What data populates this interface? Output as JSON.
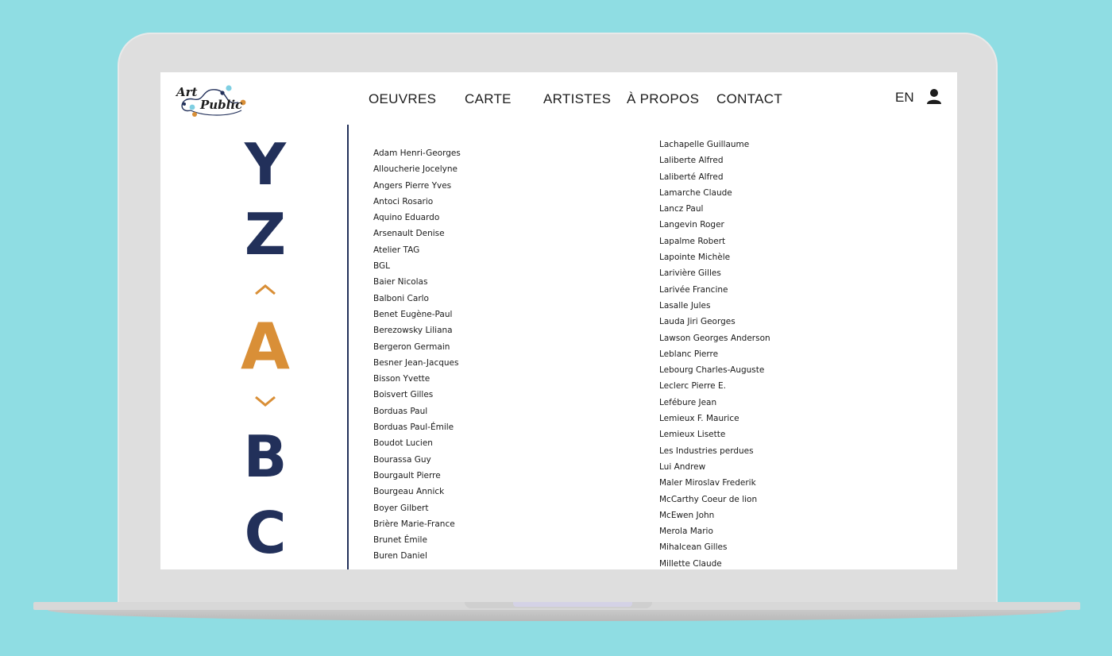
{
  "logo": {
    "line1": "Art",
    "line2": "Public"
  },
  "nav": [
    "OEUVRES",
    "CARTE",
    "ARTISTES",
    "À PROPOS",
    "CONTACT"
  ],
  "language": "EN",
  "icons": {
    "account": "user-icon",
    "prev": "chevron-up-icon",
    "next": "chevron-down-icon"
  },
  "colors": {
    "navy": "#22305a",
    "accent": "#d98f37",
    "background": "#8fdde3"
  },
  "alphabet": {
    "before": [
      "Y",
      "Z"
    ],
    "active": "A",
    "after": [
      "B",
      "C"
    ]
  },
  "artists_column1": [
    "Adam Henri-Georges",
    "Alloucherie Jocelyne",
    "Angers Pierre Yves",
    "Antoci Rosario",
    "Aquino Eduardo",
    "Arsenault Denise",
    "Atelier TAG",
    "BGL",
    "Baier Nicolas",
    "Balboni Carlo",
    "Benet Eugène-Paul",
    "Berezowsky Liliana",
    "Bergeron Germain",
    "Besner Jean-Jacques",
    "Bisson Yvette",
    "Boisvert Gilles",
    "Borduas Paul",
    "Borduas Paul-Émile",
    "Boudot Lucien",
    "Bourassa Guy",
    "Bourgault Pierre",
    "Bourgeau Annick",
    "Boyer Gilbert",
    "Brière Marie-France",
    "Brunet Émile",
    "Buren Daniel"
  ],
  "artists_column2": [
    "Lachapelle Guillaume",
    "Laliberte Alfred",
    "Laliberté Alfred",
    "Lamarche Claude",
    "Lancz Paul",
    "Langevin Roger",
    "Lapalme Robert",
    "Lapointe Michèle",
    "Larivière Gilles",
    "Larivée Francine",
    "Lasalle Jules",
    "Lauda Jiri Georges",
    "Lawson Georges Anderson",
    "Leblanc Pierre",
    "Lebourg Charles-Auguste",
    "Leclerc Pierre E.",
    "Lefébure Jean",
    "Lemieux F. Maurice",
    "Lemieux Lisette",
    "Les Industries perdues",
    "Lui Andrew",
    "Maler Miroslav Frederik",
    "McCarthy Coeur de lion",
    "McEwen John",
    "Merola Mario",
    "Mihalcean Gilles",
    "Millette Claude"
  ]
}
